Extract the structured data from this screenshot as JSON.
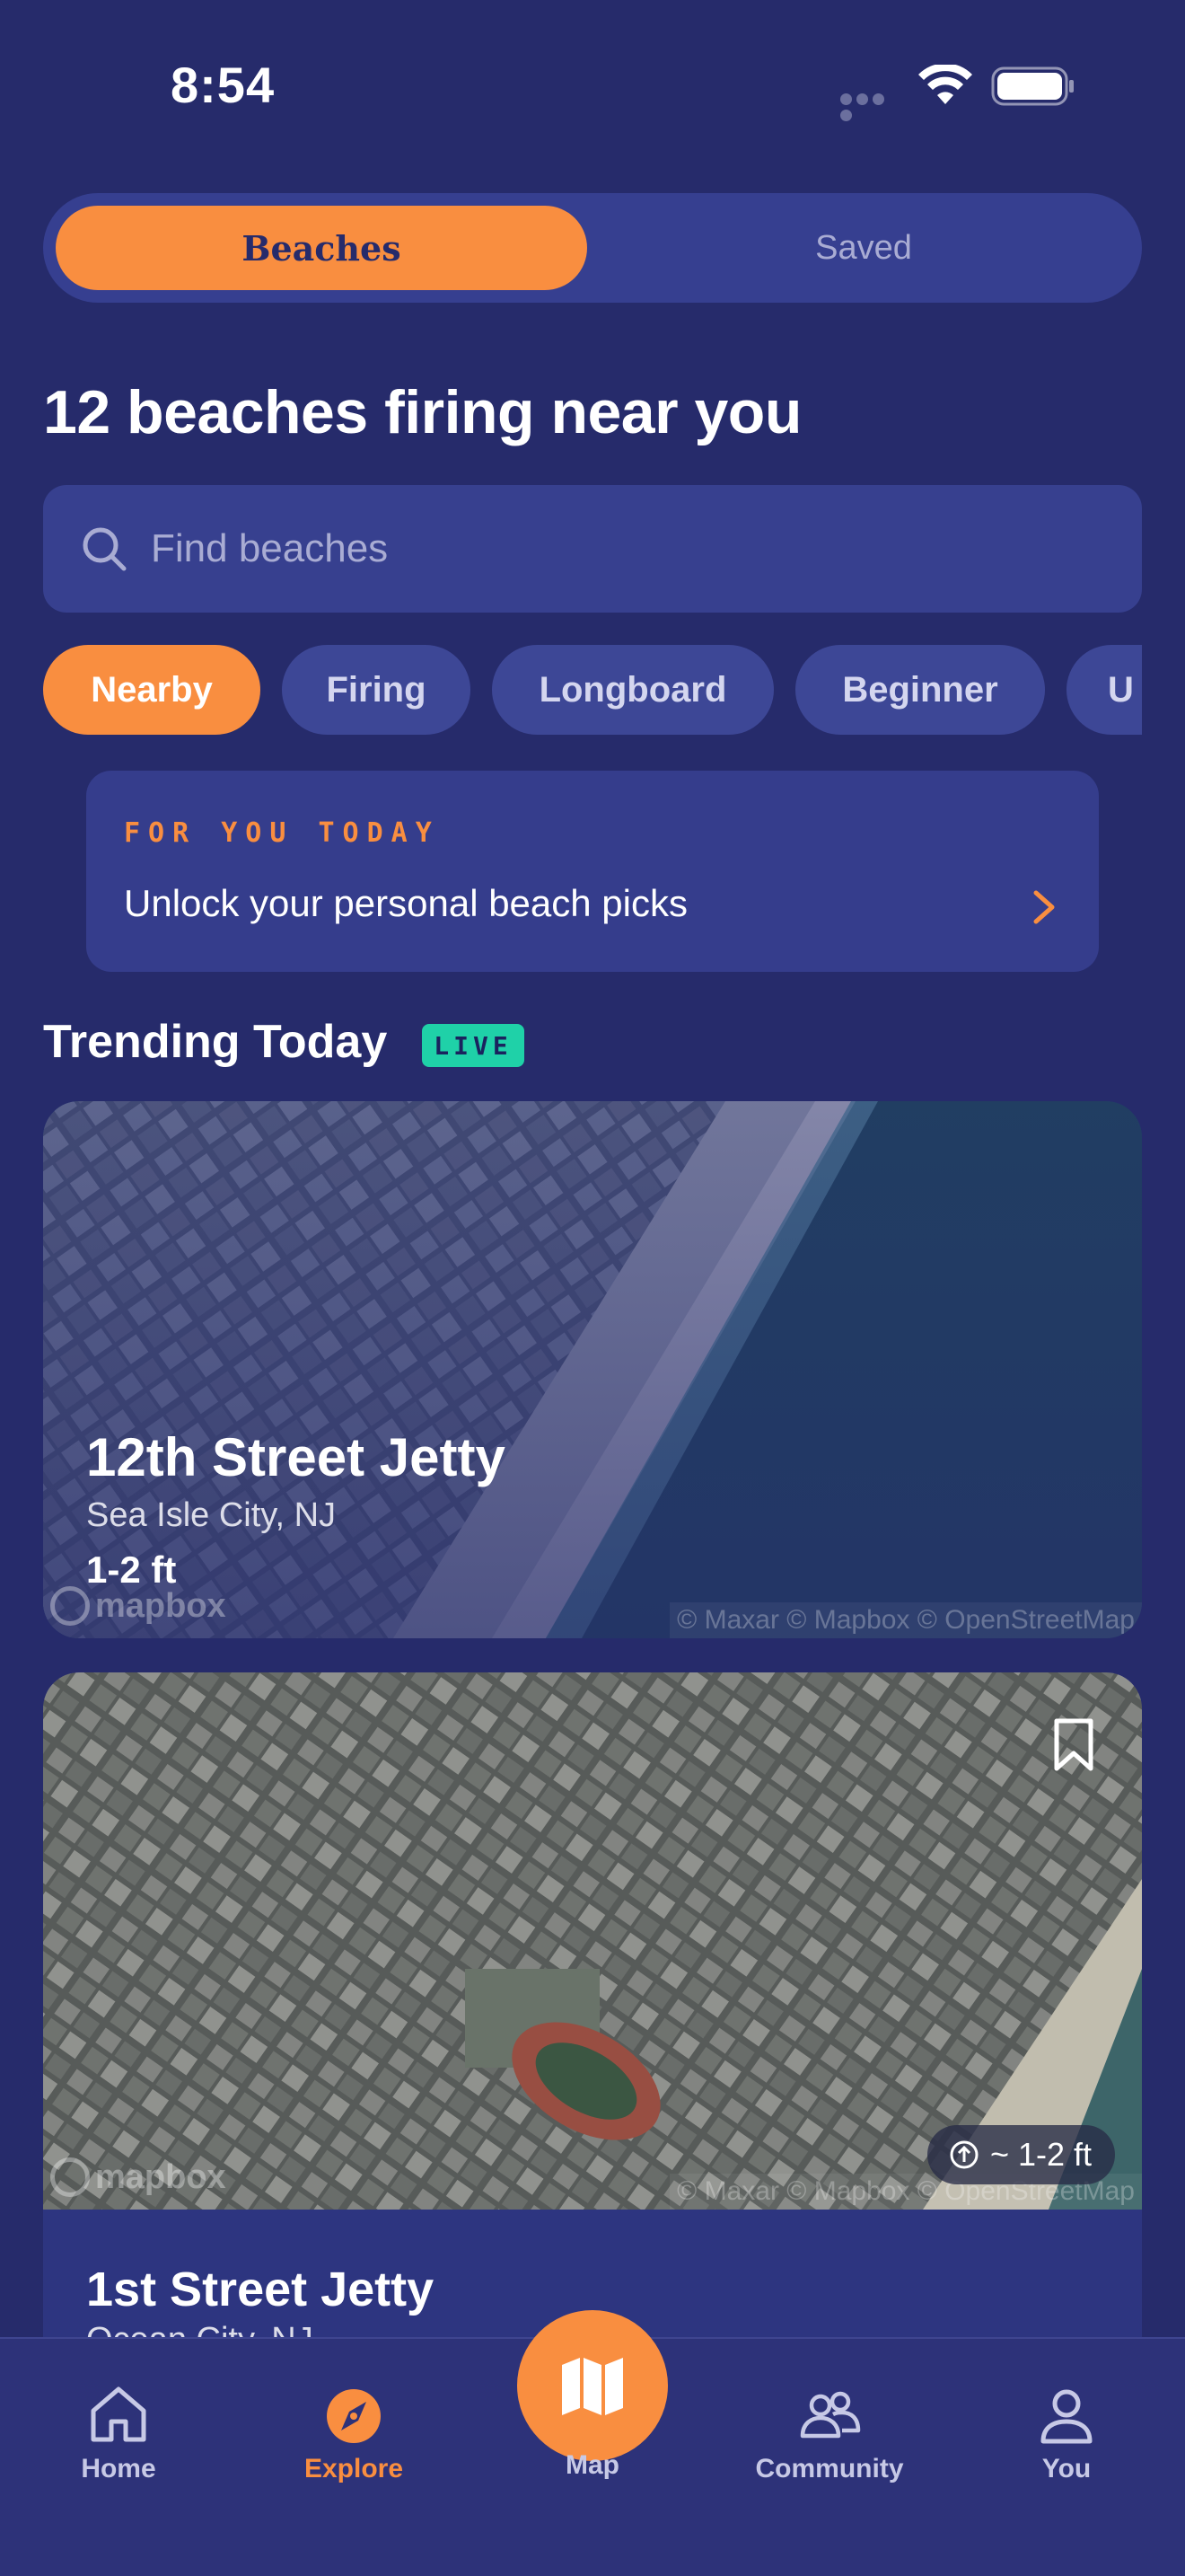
{
  "status_bar": {
    "time": "8:54"
  },
  "segmented": {
    "active_label": "Beaches",
    "inactive_label": "Saved"
  },
  "heading": "12 beaches firing near you",
  "search": {
    "placeholder": "Find beaches",
    "value": ""
  },
  "chips": [
    {
      "label": "Nearby",
      "active": true
    },
    {
      "label": "Firing",
      "active": false
    },
    {
      "label": "Longboard",
      "active": false
    },
    {
      "label": "Beginner",
      "active": false
    },
    {
      "label": "U",
      "active": false
    }
  ],
  "for_you": {
    "eyebrow": "FOR YOU TODAY",
    "text": "Unlock your personal beach picks"
  },
  "trending": {
    "title": "Trending Today",
    "badge": "LIVE"
  },
  "cards": [
    {
      "name": "12th Street Jetty",
      "location": "Sea Isle City, NJ",
      "wave": "1-2 ft",
      "mapbox": "mapbox",
      "attribution": "© Maxar © Mapbox © OpenStreetMap"
    },
    {
      "name": "1st Street Jetty",
      "location": "Ocean City, NJ",
      "wave": "~ 1-2 ft",
      "mapbox": "mapbox",
      "attribution": "© Maxar © Mapbox © OpenStreetMap"
    }
  ],
  "tabs": {
    "home": "Home",
    "explore": "Explore",
    "map": "Map",
    "community": "Community",
    "you": "You"
  },
  "colors": {
    "background": "#262b6b",
    "accent": "#f98e40",
    "live": "#1fd1a8",
    "surface": "#363f90"
  }
}
